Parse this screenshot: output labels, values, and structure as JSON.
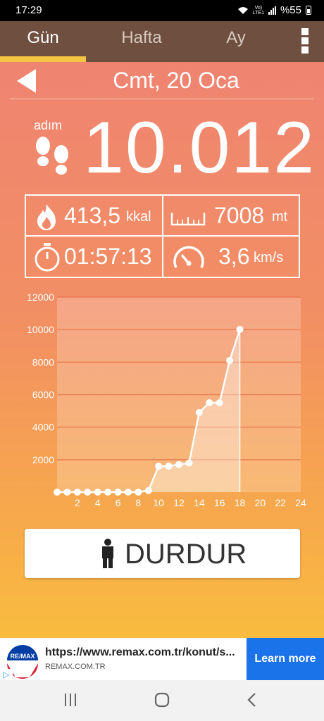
{
  "status_bar": {
    "time": "17:29",
    "network": "Vo)\nLTE1",
    "battery": "%55"
  },
  "tabs": [
    {
      "label": "Gün",
      "active": true
    },
    {
      "label": "Hafta",
      "active": false
    },
    {
      "label": "Ay",
      "active": false
    }
  ],
  "date_label": "Cmt, 20 Oca",
  "steps": {
    "label": "adım",
    "value": "10.012"
  },
  "stats": {
    "calories": {
      "value": "413,5",
      "unit": "kkal"
    },
    "distance": {
      "value": "7008",
      "unit": "mt"
    },
    "duration": {
      "value": "01:57:13"
    },
    "speed": {
      "value": "3,6",
      "unit": "km/s"
    }
  },
  "chart_data": {
    "type": "area",
    "x": [
      0,
      1,
      2,
      3,
      4,
      5,
      6,
      7,
      8,
      9,
      10,
      11,
      12,
      13,
      14,
      15,
      16,
      17,
      18
    ],
    "values": [
      0,
      0,
      0,
      0,
      0,
      0,
      0,
      0,
      0,
      100,
      1600,
      1600,
      1700,
      1800,
      4900,
      5500,
      5500,
      8100,
      10012
    ],
    "xticks": [
      "2",
      "4",
      "6",
      "8",
      "10",
      "12",
      "14",
      "16",
      "18",
      "20",
      "22",
      "24"
    ],
    "yticks": [
      "12000",
      "10000",
      "8000",
      "6000",
      "4000",
      "2000"
    ],
    "xlim": [
      0,
      24
    ],
    "ylim": [
      0,
      12000
    ],
    "grid": true
  },
  "stop_button": {
    "label": "DURDUR"
  },
  "ad": {
    "url": "https://www.remax.com.tr/konut/s...",
    "domain": "REMAX.COM.TR",
    "cta": "Learn more",
    "logo_text": "RE/MAX",
    "choice": "▷"
  },
  "colors": {
    "accent": "#f4c542",
    "header": "#6e4f40",
    "ad_button": "#1a73e8"
  }
}
